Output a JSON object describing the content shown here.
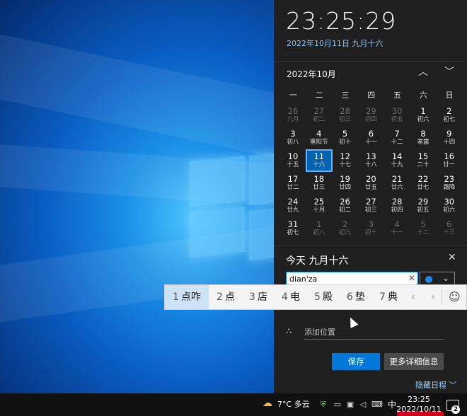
{
  "flyout": {
    "time": "23:25:29",
    "date_line": "2022年10月11日 九月十六",
    "calendar": {
      "month_title": "2022年10月",
      "nav_up": "︿",
      "nav_down": "﹀",
      "weekdays": [
        "一",
        "二",
        "三",
        "四",
        "五",
        "六",
        "日"
      ],
      "weeks": [
        [
          {
            "d": "26",
            "l": "九月",
            "o": true
          },
          {
            "d": "27",
            "l": "初二",
            "o": true
          },
          {
            "d": "28",
            "l": "初三",
            "o": true
          },
          {
            "d": "29",
            "l": "初四",
            "o": true
          },
          {
            "d": "30",
            "l": "初五",
            "o": true
          },
          {
            "d": "1",
            "l": "初六"
          },
          {
            "d": "2",
            "l": "初七"
          }
        ],
        [
          {
            "d": "3",
            "l": "初八"
          },
          {
            "d": "4",
            "l": "重阳节"
          },
          {
            "d": "5",
            "l": "初十"
          },
          {
            "d": "6",
            "l": "十一"
          },
          {
            "d": "7",
            "l": "十二"
          },
          {
            "d": "8",
            "l": "寒露"
          },
          {
            "d": "9",
            "l": "十四"
          }
        ],
        [
          {
            "d": "10",
            "l": "十五"
          },
          {
            "d": "11",
            "l": "十六",
            "t": true
          },
          {
            "d": "12",
            "l": "十七"
          },
          {
            "d": "13",
            "l": "十八"
          },
          {
            "d": "14",
            "l": "十九"
          },
          {
            "d": "15",
            "l": "二十"
          },
          {
            "d": "16",
            "l": "廿一"
          }
        ],
        [
          {
            "d": "17",
            "l": "廿二"
          },
          {
            "d": "18",
            "l": "廿三"
          },
          {
            "d": "19",
            "l": "廿四"
          },
          {
            "d": "20",
            "l": "廿五"
          },
          {
            "d": "21",
            "l": "廿六"
          },
          {
            "d": "22",
            "l": "廿七"
          },
          {
            "d": "23",
            "l": "霜降"
          }
        ],
        [
          {
            "d": "24",
            "l": "廿九"
          },
          {
            "d": "25",
            "l": "十月"
          },
          {
            "d": "26",
            "l": "初二"
          },
          {
            "d": "27",
            "l": "初三"
          },
          {
            "d": "28",
            "l": "初四"
          },
          {
            "d": "29",
            "l": "初五"
          },
          {
            "d": "30",
            "l": "初六"
          }
        ],
        [
          {
            "d": "31",
            "l": "初七"
          },
          {
            "d": "1",
            "l": "初八",
            "o": true
          },
          {
            "d": "2",
            "l": "初九",
            "o": true
          },
          {
            "d": "3",
            "l": "初十",
            "o": true
          },
          {
            "d": "4",
            "l": "十一",
            "o": true
          },
          {
            "d": "5",
            "l": "十二",
            "o": true
          },
          {
            "d": "6",
            "l": "十三",
            "o": true
          }
        ]
      ]
    },
    "agenda": {
      "title": "今天 九月十六",
      "close": "✕",
      "event_value": "dian'za",
      "clear": "✕",
      "calendar_color": "#1e88e5",
      "location_placeholder": "添加位置",
      "save": "保存",
      "more": "更多详细信息",
      "hide": "隐藏日程 ﹀"
    }
  },
  "ime": {
    "candidates": [
      {
        "num": "1",
        "text": "点咋"
      },
      {
        "num": "2",
        "text": "点"
      },
      {
        "num": "3",
        "text": "店"
      },
      {
        "num": "4",
        "text": "电"
      },
      {
        "num": "5",
        "text": "殿"
      },
      {
        "num": "6",
        "text": "垫"
      },
      {
        "num": "7",
        "text": "典"
      }
    ],
    "prev": "‹",
    "next": "›",
    "emoji": "☺"
  },
  "taskbar": {
    "weather": "7°C 多云",
    "ime_mode": "中",
    "time": "23:25",
    "date": "2022/10/11",
    "notifications": "2"
  }
}
